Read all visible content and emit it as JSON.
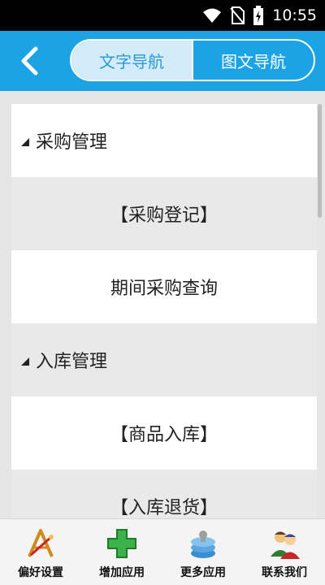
{
  "status_bar": {
    "time": "10:55",
    "icons": [
      "wifi-icon",
      "no-sim-icon",
      "battery-charging-icon"
    ]
  },
  "header": {
    "back_icon": "chevron-left-icon",
    "tabs": [
      {
        "label": "文字导航",
        "active": true
      },
      {
        "label": "图文导航",
        "active": false
      }
    ],
    "colors": {
      "bar": "#1ca3e6",
      "active_tab_bg": "#d4ecf9",
      "active_tab_text": "#2a9ad8"
    }
  },
  "menu": {
    "rows": [
      {
        "type": "group",
        "label": "采购管理"
      },
      {
        "type": "item",
        "label": "【采购登记】"
      },
      {
        "type": "item",
        "label": "期间采购查询"
      },
      {
        "type": "group",
        "label": "入库管理"
      },
      {
        "type": "item",
        "label": "【商品入库】"
      },
      {
        "type": "item",
        "label": "【入库退货】"
      }
    ]
  },
  "bottom_nav": {
    "items": [
      {
        "label": "偏好设置",
        "icon": "preferences-icon"
      },
      {
        "label": "增加应用",
        "icon": "add-app-icon"
      },
      {
        "label": "更多应用",
        "icon": "more-apps-icon"
      },
      {
        "label": "联系我们",
        "icon": "contact-us-icon"
      }
    ]
  }
}
